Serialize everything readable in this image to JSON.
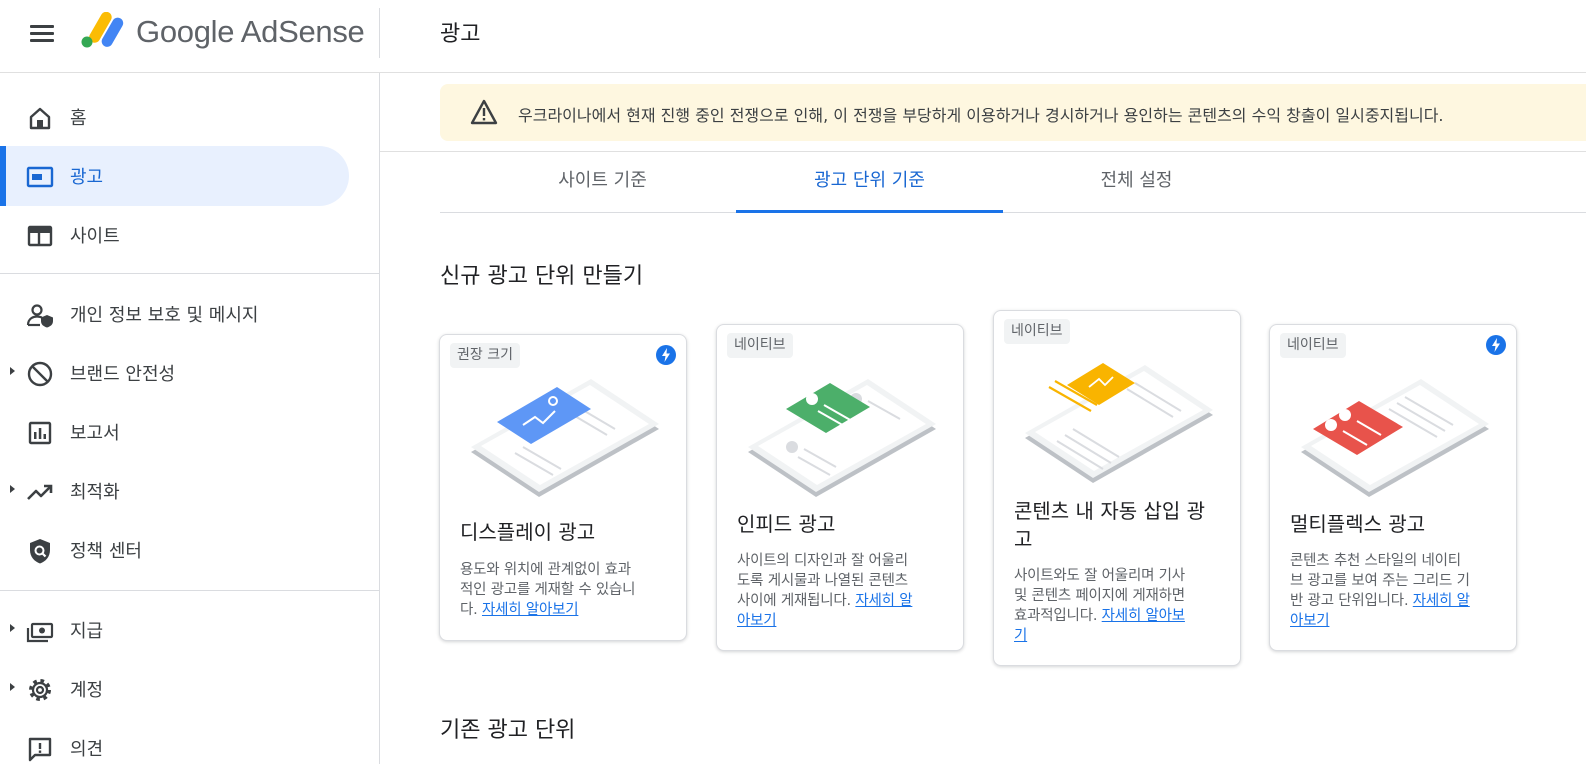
{
  "header": {
    "logo_text": "Google AdSense",
    "page_title": "광고"
  },
  "sidebar": {
    "items": [
      {
        "label": "홈",
        "icon": "home-icon"
      },
      {
        "label": "광고",
        "icon": "ads-icon"
      },
      {
        "label": "사이트",
        "icon": "sites-icon"
      },
      {
        "label": "개인 정보 보호 및 메시지",
        "icon": "privacy-messaging-icon"
      },
      {
        "label": "브랜드 안전성",
        "icon": "block-icon"
      },
      {
        "label": "보고서",
        "icon": "bar-chart-icon"
      },
      {
        "label": "최적화",
        "icon": "trending-up-icon"
      },
      {
        "label": "정책 센터",
        "icon": "policy-shield-icon"
      },
      {
        "label": "지급",
        "icon": "payments-icon"
      },
      {
        "label": "계정",
        "icon": "gear-icon"
      },
      {
        "label": "의견",
        "icon": "feedback-icon"
      }
    ]
  },
  "banner": {
    "text": "우크라이나에서 현재 진행 중인 전쟁으로 인해, 이 전쟁을 부당하게 이용하거나 경시하거나 용인하는 콘텐츠의 수익 창출이 일시중지됩니다."
  },
  "tabs": [
    {
      "label": "사이트 기준"
    },
    {
      "label": "광고 단위 기준"
    },
    {
      "label": "전체 설정"
    }
  ],
  "main": {
    "new_section_title": "신규 광고 단위 만들기",
    "existing_section_title": "기존 광고 단위"
  },
  "cards": [
    {
      "chip": "권장 크기",
      "title_lines": [
        "디스플레이 광고"
      ],
      "desc_lines": [
        "용도와 위치에 관계없이 효과",
        "적인 광고를 게재할 수 있습니",
        "다."
      ],
      "link_lines": [
        "자세히 알아보기"
      ]
    },
    {
      "chip": "네이티브",
      "title_lines": [
        "인피드 광고"
      ],
      "desc_lines": [
        "사이트의 디자인과 잘 어울리",
        "도록 게시물과 나열된 콘텐츠",
        "사이에 게재됩니다."
      ],
      "link_lines": [
        "자세히 알",
        "아보기"
      ]
    },
    {
      "chip": "네이티브",
      "title_lines": [
        "콘텐츠 내 자동 삽입 광",
        "고"
      ],
      "desc_lines": [
        "사이트와도 잘 어울리며 기사",
        "및 콘텐츠 페이지에 게재하면",
        "효과적입니다."
      ],
      "link_lines": [
        "자세히 알아보",
        "기"
      ]
    },
    {
      "chip": "네이티브",
      "title_lines": [
        "멀티플렉스 광고"
      ],
      "desc_lines": [
        "콘텐츠 추천 스타일의 네이티",
        "브 광고를 보여 주는 그리드 기",
        "반 광고 단위입니다."
      ],
      "link_lines": [
        "자세히 알",
        "아보기"
      ]
    }
  ],
  "colors": {
    "accent": "#1a73e8",
    "active_nav_bg": "#e8f0fe",
    "banner_bg": "#fef7e0",
    "display_ad": "#5e97f6",
    "infeed_ad": "#4caf6a",
    "inarticle_ad": "#f9b400",
    "multiplex_ad": "#e8534b"
  }
}
